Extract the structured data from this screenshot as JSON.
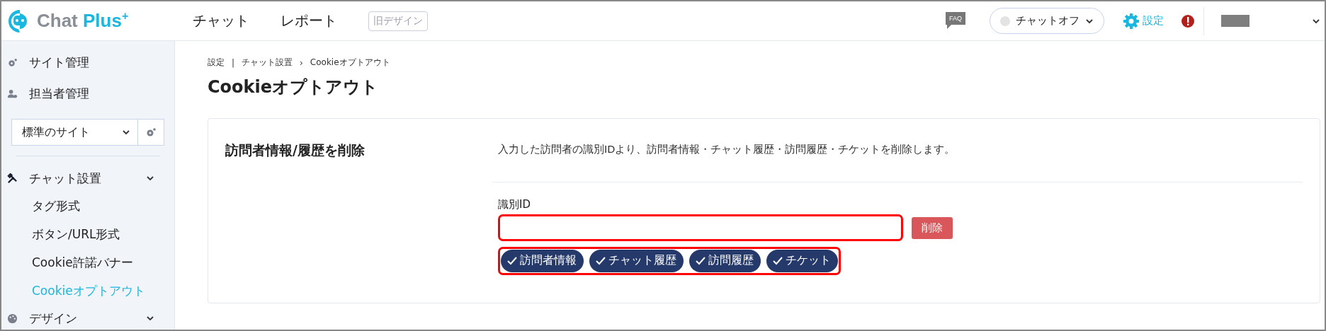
{
  "header": {
    "logo": {
      "text_main": "Chat ",
      "text_accent": "Plus",
      "mark": "+"
    },
    "nav": [
      {
        "label": "チャット"
      },
      {
        "label": "レポート"
      }
    ],
    "old_design_button": "旧デザイン",
    "faq": "FAQ",
    "chat_status": {
      "label": "チャットオフ",
      "on": false
    },
    "settings": "設定"
  },
  "sidebar": {
    "items": [
      {
        "label": "サイト管理",
        "kind": "gear"
      },
      {
        "label": "担当者管理",
        "kind": "people"
      }
    ],
    "site_select": {
      "value": "標準のサイト"
    },
    "sections": [
      {
        "label": "チャット設置",
        "kind": "tools",
        "children": [
          {
            "label": "タグ形式",
            "selected": false
          },
          {
            "label": "ボタン/URL形式",
            "selected": false
          },
          {
            "label": "Cookie許諾バナー",
            "selected": false
          },
          {
            "label": "Cookieオプトアウト",
            "selected": true
          }
        ]
      },
      {
        "label": "デザイン",
        "kind": "palette"
      }
    ]
  },
  "breadcrumb": [
    {
      "label": "設定"
    },
    {
      "separator": "|",
      "label": "チャット設置"
    },
    {
      "separator": "›",
      "label": "Cookieオプトアウト"
    }
  ],
  "page_title": "Cookieオプトアウト",
  "card": {
    "title": "訪問者情報/履歴を削除",
    "description": "入力した訪問者の識別IDより、訪問者情報・チャット履歴・訪問履歴・チケットを削除します。",
    "field_label": "識別ID",
    "delete_button": "削除",
    "options": [
      {
        "label": "訪問者情報",
        "selected": true
      },
      {
        "label": "チャット履歴",
        "selected": true
      },
      {
        "label": "訪問履歴",
        "selected": true
      },
      {
        "label": "チケット",
        "selected": true
      }
    ]
  }
}
